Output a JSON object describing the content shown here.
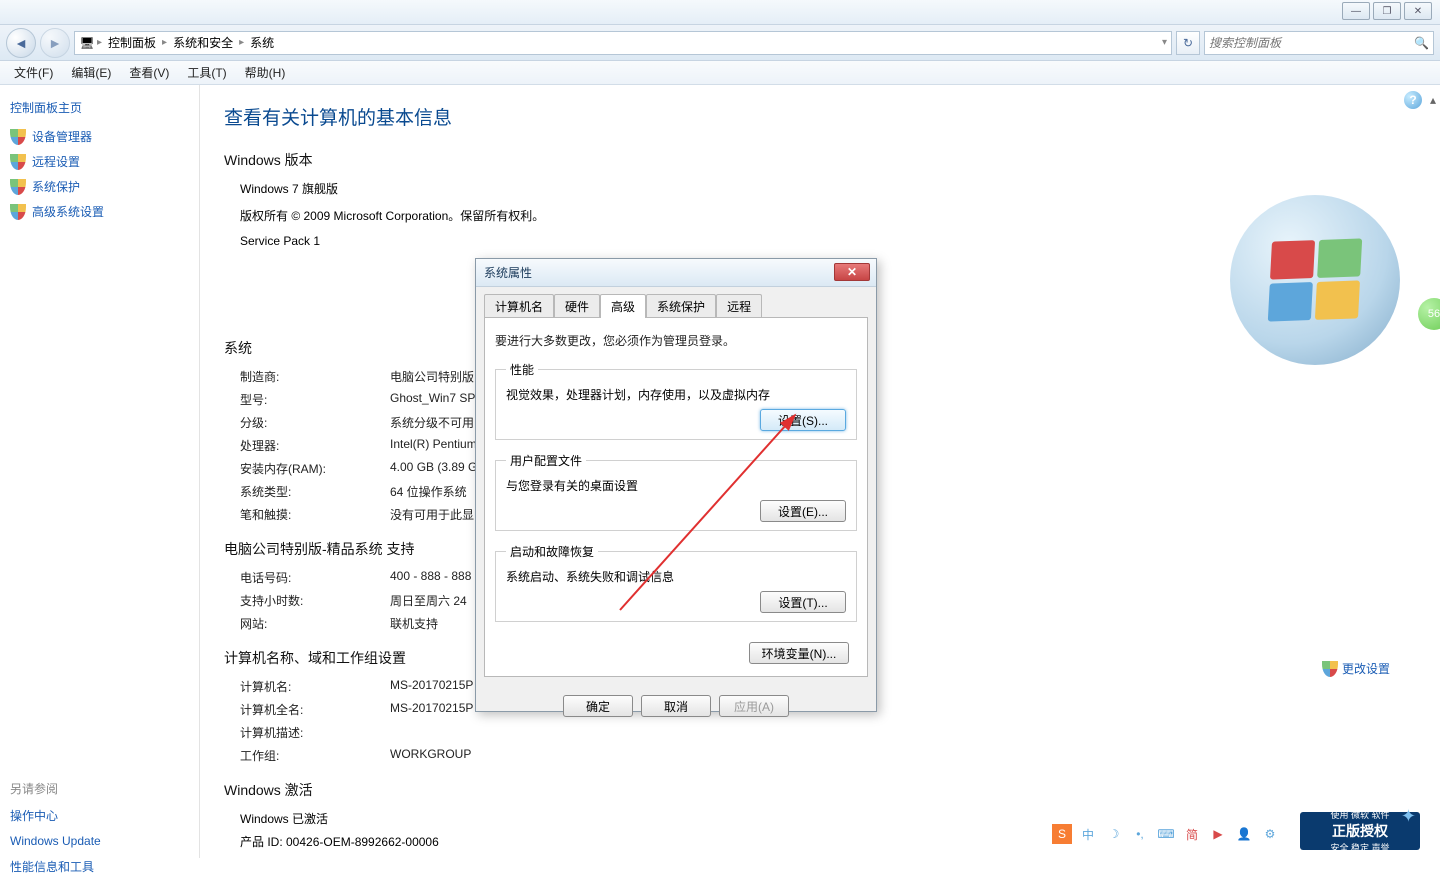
{
  "window": {
    "minimize": "—",
    "maximize": "❐",
    "close": "✕"
  },
  "breadcrumb": {
    "items": [
      "控制面板",
      "系统和安全",
      "系统"
    ]
  },
  "search": {
    "placeholder": "搜索控制面板"
  },
  "menus": [
    "文件(F)",
    "编辑(E)",
    "查看(V)",
    "工具(T)",
    "帮助(H)"
  ],
  "sidebar": {
    "home": "控制面板主页",
    "links": [
      "设备管理器",
      "远程设置",
      "系统保护",
      "高级系统设置"
    ],
    "see_also_title": "另请参阅",
    "see_also": [
      "操作中心",
      "Windows Update",
      "性能信息和工具"
    ]
  },
  "page": {
    "title": "查看有关计算机的基本信息",
    "edition_head": "Windows 版本",
    "edition": "Windows 7 旗舰版",
    "copyright": "版权所有 © 2009 Microsoft Corporation。保留所有权利。",
    "servicepack": "Service Pack 1",
    "system_head": "系统",
    "system": {
      "manufacturer_label": "制造商:",
      "manufacturer": "电脑公司特别版",
      "model_label": "型号:",
      "model": "Ghost_Win7 SP",
      "rating_label": "分级:",
      "rating": "系统分级不可用",
      "processor_label": "处理器:",
      "processor": "Intel(R) Pentium",
      "ram_label": "安装内存(RAM):",
      "ram": "4.00 GB (3.89 G",
      "systype_label": "系统类型:",
      "systype": "64 位操作系统",
      "pen_label": "笔和触摸:",
      "pen": "没有可用于此显"
    },
    "support_head": "电脑公司特别版-精品系统 支持",
    "support": {
      "phone_label": "电话号码:",
      "phone": "400 - 888 - 888",
      "hours_label": "支持小时数:",
      "hours": "周日至周六  24",
      "site_label": "网站:",
      "site": "联机支持"
    },
    "name_head": "计算机名称、域和工作组设置",
    "name": {
      "computer_label": "计算机名:",
      "computer": "MS-20170215P",
      "full_label": "计算机全名:",
      "full": "MS-20170215P",
      "desc_label": "计算机描述:",
      "desc": "",
      "workgroup_label": "工作组:",
      "workgroup": "WORKGROUP"
    },
    "change_settings": "更改设置",
    "activation_head": "Windows 激活",
    "activation_status": "Windows 已激活",
    "product_id": "产品 ID: 00426-OEM-8992662-00006",
    "genuine_big": "正版授权",
    "genuine_small1": "使用 微软 软件",
    "genuine_small2": "安全 稳定 声誉"
  },
  "dialog": {
    "title": "系统属性",
    "tabs": [
      "计算机名",
      "硬件",
      "高级",
      "系统保护",
      "远程"
    ],
    "note": "要进行大多数更改，您必须作为管理员登录。",
    "perf": {
      "legend": "性能",
      "desc": "视觉效果，处理器计划，内存使用，以及虚拟内存",
      "btn": "设置(S)..."
    },
    "profile": {
      "legend": "用户配置文件",
      "desc": "与您登录有关的桌面设置",
      "btn": "设置(E)..."
    },
    "startup": {
      "legend": "启动和故障恢复",
      "desc": "系统启动、系统失败和调试信息",
      "btn": "设置(T)..."
    },
    "env_btn": "环境变量(N)...",
    "ok": "确定",
    "cancel": "取消",
    "apply": "应用(A)"
  },
  "ime": {
    "zhong": "中",
    "jian": "简"
  },
  "badge56": "56"
}
